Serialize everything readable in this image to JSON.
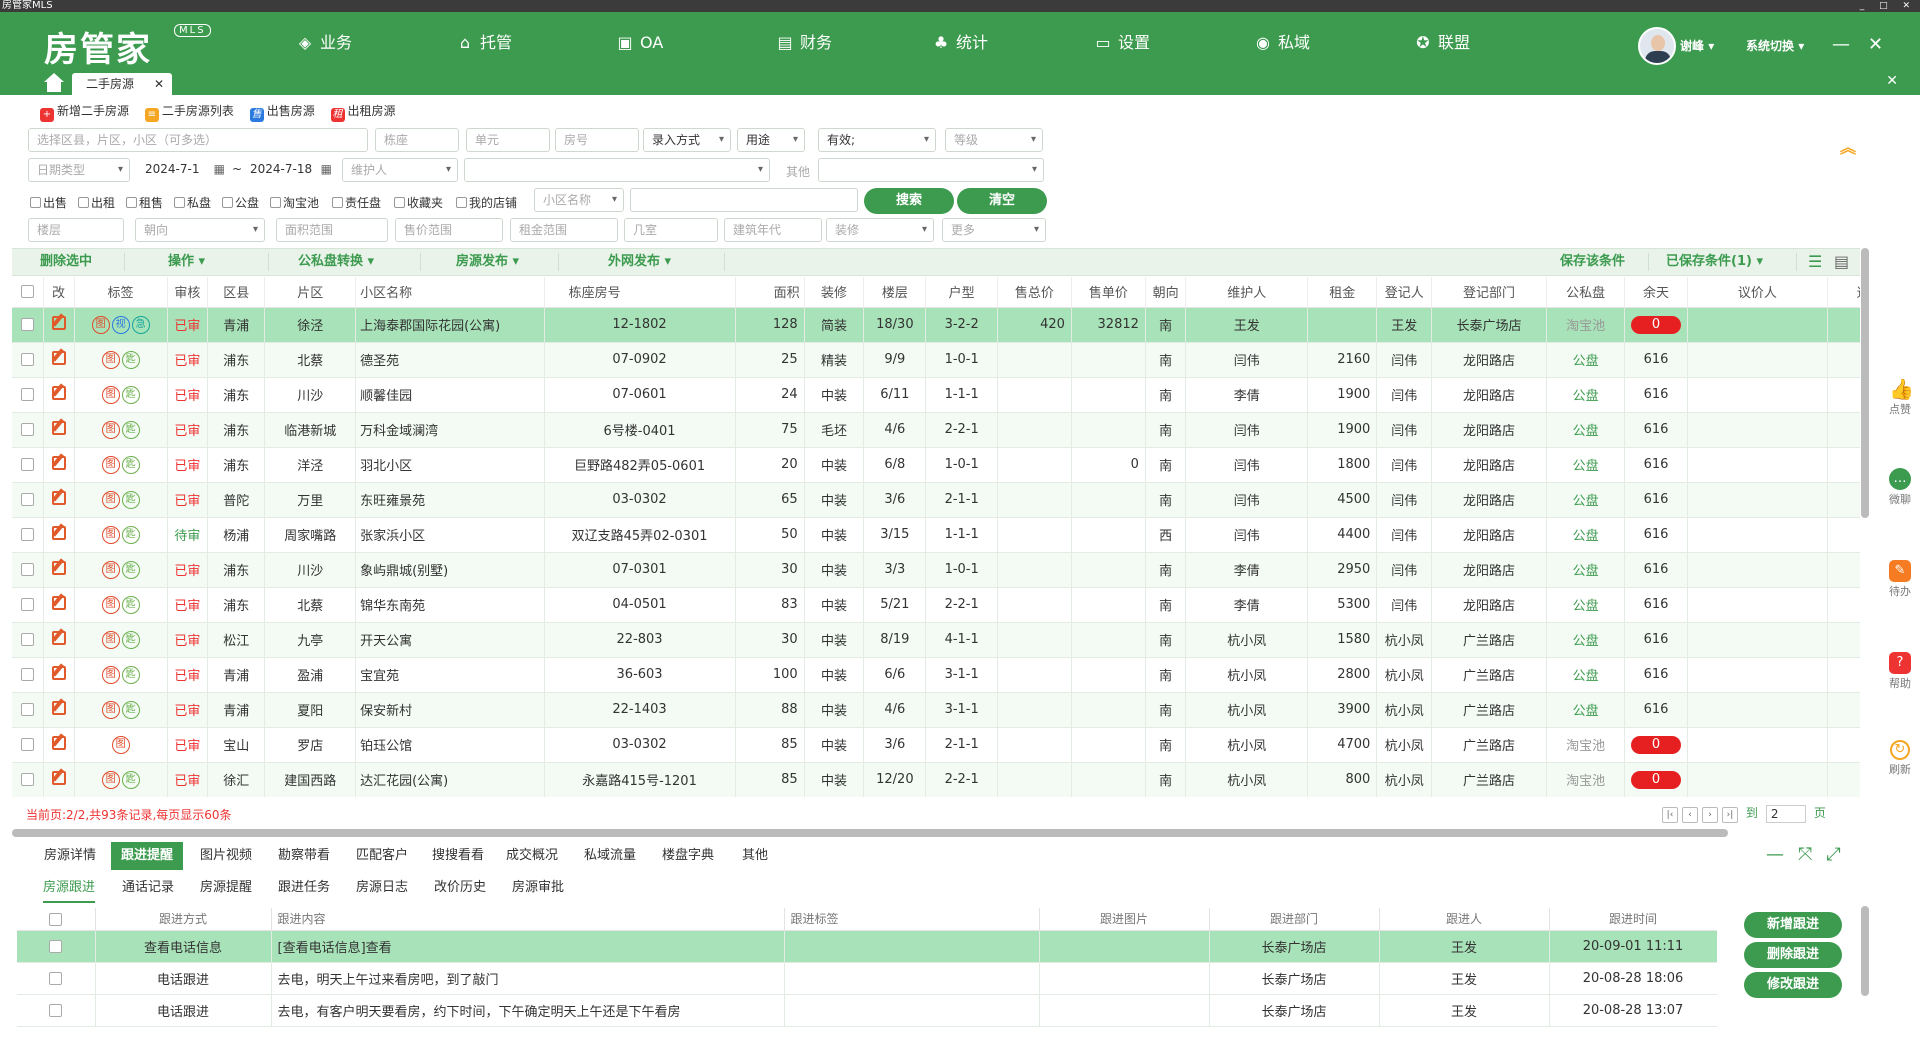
{
  "app": {
    "window_title": "房管家MLS",
    "window_controls": "_ □ ✕",
    "logo": "房管家",
    "logo_badge": "MLS",
    "user_name": "谢峰",
    "system_switch": "系统切换"
  },
  "nav": [
    {
      "label": "业务",
      "icon": "briefcase-icon"
    },
    {
      "label": "托管",
      "icon": "home-hand-icon"
    },
    {
      "label": "OA",
      "icon": "box-icon"
    },
    {
      "label": "财务",
      "icon": "wallet-icon"
    },
    {
      "label": "统计",
      "icon": "org-chart-icon"
    },
    {
      "label": "设置",
      "icon": "monitor-icon"
    },
    {
      "label": "私域",
      "icon": "disc-icon"
    },
    {
      "label": "联盟",
      "icon": "star-icon"
    }
  ],
  "tab": {
    "label": "二手房源",
    "close": "✕"
  },
  "toolbar": {
    "add": "新增二手房源",
    "list": "二手房源列表",
    "sale": "出售房源",
    "rent": "出租房源"
  },
  "filters": {
    "region_ph": "选择区县，片区，小区（可多选）",
    "building_ph": "栋座",
    "unit_ph": "单元",
    "room_ph": "房号",
    "entry": "录入方式",
    "usage": "用途",
    "valid": "有效;",
    "level": "等级",
    "date_type": "日期类型",
    "date_from": "2024-7-1",
    "tilde": "~",
    "date_to": "2024-7-18",
    "maintainer": "维护人",
    "other": "其他",
    "community_ph": "小区名称",
    "floor": "楼层",
    "orientation": "朝向",
    "area": "面积范围",
    "price": "售价范围",
    "rent": "租金范围",
    "rooms": "几室",
    "year": "建筑年代",
    "decoration": "装修",
    "more": "更多",
    "search": "搜索",
    "clear": "清空"
  },
  "checks": [
    "出售",
    "出租",
    "租售",
    "私盘",
    "公盘",
    "淘宝池",
    "责任盘",
    "收藏夹",
    "我的店铺"
  ],
  "opbar": {
    "delete": "删除选中",
    "operate": "操作",
    "public_convert": "公私盘转换",
    "publish": "房源发布",
    "external": "外网发布",
    "save_cond": "保存该条件",
    "saved_cond": "已保存条件(1)"
  },
  "columns": [
    "改",
    "标签",
    "审核",
    "区县",
    "片区",
    "小区名称",
    "栋座房号",
    "面积",
    "装修",
    "楼层",
    "户型",
    "售总价",
    "售单价",
    "朝向",
    "维护人",
    "租金",
    "登记人",
    "登记部门",
    "公私盘",
    "余天",
    "议价人",
    "速销"
  ],
  "tag_glyphs": {
    "r": "图",
    "g": "匙",
    "b": "视",
    "c": "急"
  },
  "rows": [
    [
      "已审",
      "青浦",
      "徐泾",
      "上海泰郡国际花园(公寓)",
      "12-1802",
      "128",
      "简装",
      "18/30",
      "3-2-2",
      "420",
      "32812",
      "南",
      "王发",
      "",
      "王发",
      "长泰广场店",
      "淘宝池",
      "0"
    ],
    [
      "已审",
      "浦东",
      "北蔡",
      "德圣苑",
      "07-0902",
      "25",
      "精装",
      "9/9",
      "1-0-1",
      "",
      "",
      "南",
      "闫伟",
      "2160",
      "闫伟",
      "龙阳路店",
      "公盘",
      "616"
    ],
    [
      "已审",
      "浦东",
      "川沙",
      "顺馨佳园",
      "07-0601",
      "24",
      "中装",
      "6/11",
      "1-1-1",
      "",
      "",
      "南",
      "李倩",
      "1900",
      "闫伟",
      "龙阳路店",
      "公盘",
      "616"
    ],
    [
      "已审",
      "浦东",
      "临港新城",
      "万科金域澜湾",
      "6号楼-0401",
      "75",
      "毛坯",
      "4/6",
      "2-2-1",
      "",
      "",
      "南",
      "闫伟",
      "1900",
      "闫伟",
      "龙阳路店",
      "公盘",
      "616"
    ],
    [
      "已审",
      "浦东",
      "洋泾",
      "羽北小区",
      "巨野路482弄05-0601",
      "20",
      "中装",
      "6/8",
      "1-0-1",
      "",
      "0",
      "南",
      "闫伟",
      "1800",
      "闫伟",
      "龙阳路店",
      "公盘",
      "616"
    ],
    [
      "已审",
      "普陀",
      "万里",
      "东旺雍景苑",
      "03-0302",
      "65",
      "中装",
      "3/6",
      "2-1-1",
      "",
      "",
      "南",
      "闫伟",
      "4500",
      "闫伟",
      "龙阳路店",
      "公盘",
      "616"
    ],
    [
      "待审",
      "杨浦",
      "周家嘴路",
      "张家浜小区",
      "双辽支路45弄02-0301",
      "50",
      "中装",
      "3/15",
      "1-1-1",
      "",
      "",
      "西",
      "闫伟",
      "4400",
      "闫伟",
      "龙阳路店",
      "公盘",
      "616"
    ],
    [
      "已审",
      "浦东",
      "川沙",
      "象屿鼎城(别墅)",
      "07-0301",
      "30",
      "中装",
      "3/3",
      "1-0-1",
      "",
      "",
      "南",
      "李倩",
      "2950",
      "闫伟",
      "龙阳路店",
      "公盘",
      "616"
    ],
    [
      "已审",
      "浦东",
      "北蔡",
      "锦华东南苑",
      "04-0501",
      "83",
      "中装",
      "5/21",
      "2-2-1",
      "",
      "",
      "南",
      "李倩",
      "5300",
      "闫伟",
      "龙阳路店",
      "公盘",
      "616"
    ],
    [
      "已审",
      "松江",
      "九亭",
      "开天公寓",
      "22-803",
      "30",
      "中装",
      "8/19",
      "4-1-1",
      "",
      "",
      "南",
      "杭小凤",
      "1580",
      "杭小凤",
      "广兰路店",
      "公盘",
      "616"
    ],
    [
      "已审",
      "青浦",
      "盈浦",
      "宝宜苑",
      "36-603",
      "100",
      "中装",
      "6/6",
      "3-1-1",
      "",
      "",
      "南",
      "杭小凤",
      "2800",
      "杭小凤",
      "广兰路店",
      "公盘",
      "616"
    ],
    [
      "已审",
      "青浦",
      "夏阳",
      "保安新村",
      "22-1403",
      "88",
      "中装",
      "4/6",
      "3-1-1",
      "",
      "",
      "南",
      "杭小凤",
      "3900",
      "杭小凤",
      "广兰路店",
      "公盘",
      "616"
    ],
    [
      "已审",
      "宝山",
      "罗店",
      "铂珏公馆",
      "03-0302",
      "85",
      "中装",
      "3/6",
      "2-1-1",
      "",
      "",
      "南",
      "杭小凤",
      "4700",
      "杭小凤",
      "广兰路店",
      "淘宝池",
      "0"
    ],
    [
      "已审",
      "徐汇",
      "建国西路",
      "达汇花园(公寓)",
      "永嘉路415号-1201",
      "85",
      "中装",
      "12/20",
      "2-2-1",
      "",
      "",
      "南",
      "杭小凤",
      "800",
      "杭小凤",
      "广兰路店",
      "淘宝池",
      "0"
    ]
  ],
  "footer": {
    "info": "当前页:2/2,共93条记录,每页显示60条",
    "goto": "到",
    "page": "2",
    "page_unit": "页"
  },
  "bottom_tabs": [
    "房源详情",
    "跟进提醒",
    "图片视频",
    "勘察带看",
    "匹配客户",
    "搜搜看看",
    "成交概况",
    "私域流量",
    "楼盘字典",
    "其他"
  ],
  "sub_tabs": [
    "房源跟进",
    "通话记录",
    "房源提醒",
    "跟进任务",
    "房源日志",
    "改价历史",
    "房源审批"
  ],
  "follow_columns": [
    "跟进方式",
    "跟进内容",
    "跟进标签",
    "跟进图片",
    "跟进部门",
    "跟进人",
    "跟进时间"
  ],
  "follows": [
    [
      "查看电话信息",
      "[查看电话信息]查看",
      "",
      "",
      "长泰广场店",
      "王发",
      "20-09-01 11:11"
    ],
    [
      "电话跟进",
      "去电，明天上午过来看房吧，到了敲门",
      "",
      "",
      "长泰广场店",
      "王发",
      "20-08-28 18:06"
    ],
    [
      "电话跟进",
      "去电，有客户明天要看房，约下时间，下午确定明天上午还是下午看房",
      "",
      "",
      "长泰广场店",
      "王发",
      "20-08-28 13:07"
    ]
  ],
  "follow_buttons": {
    "add": "新增跟进",
    "delete": "删除跟进",
    "modify": "修改跟进"
  },
  "rightbar": [
    {
      "label": "点赞",
      "icon": "thumbs-up-icon",
      "color": "#f5a623"
    },
    {
      "label": "微聊",
      "icon": "chat-icon",
      "color": "#3d9b4f"
    },
    {
      "label": "待办",
      "icon": "todo-icon",
      "color": "#f57c23"
    },
    {
      "label": "帮助",
      "icon": "help-icon",
      "color": "#e33"
    },
    {
      "label": "刷新",
      "icon": "refresh-icon",
      "color": "#f5a623"
    }
  ],
  "colors": {
    "brand": "#3d9b4f",
    "selected_row": "#a8e2b8",
    "alert": "#e62020"
  }
}
